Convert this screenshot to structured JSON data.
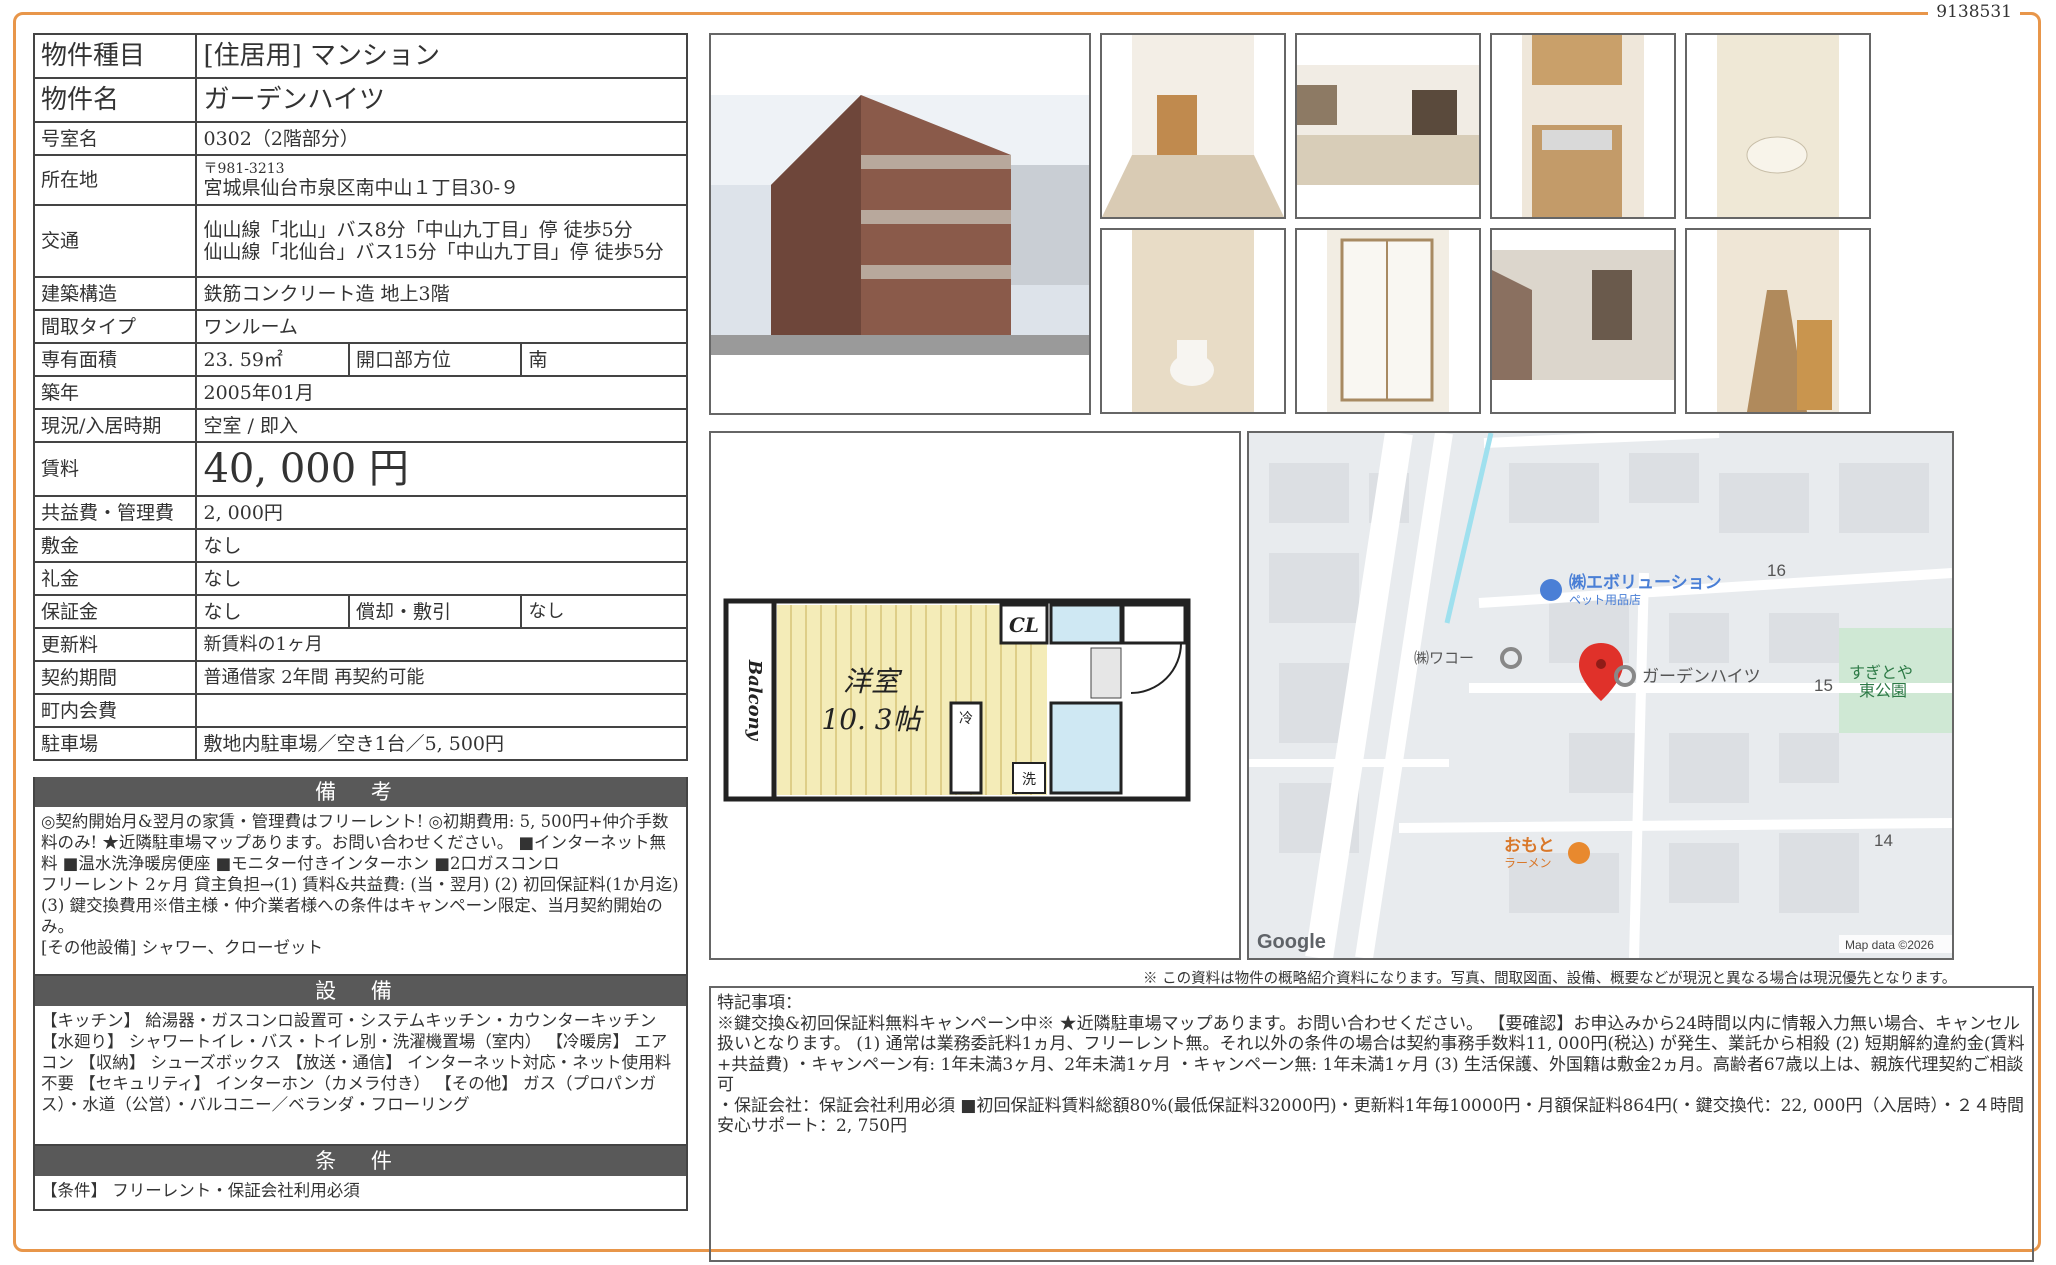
{
  "doc_id": "9138531",
  "spec": {
    "type_label": "物件種目",
    "type_value": "[住居用]  マンション",
    "name_label": "物件名",
    "name_value": "ガーデンハイツ",
    "room_label": "号室名",
    "room_value": "0302（2階部分）",
    "address_label": "所在地",
    "zip": "〒981-3213",
    "address": "宮城県仙台市泉区南中山１丁目30-９",
    "transit_label": "交通",
    "transit_1": "仙山線「北山」バス8分「中山九丁目」停  徒歩5分",
    "transit_2": "仙山線「北仙台」バス15分「中山九丁目」停  徒歩5分",
    "structure_label": "建築構造",
    "structure_value": "鉄筋コンクリート造  地上3階",
    "layout_label": "間取タイプ",
    "layout_value": "ワンルーム",
    "area_label": "専有面積",
    "area_value": "23. 59㎡",
    "direction_label": "開口部方位",
    "direction_value": "南",
    "built_label": "築年",
    "built_value": "2005年01月",
    "status_label": "現況/入居時期",
    "status_value": "空室  /  即入",
    "rent_label": "賃料",
    "rent_value": "40, 000  円",
    "fee_label": "共益費・管理費",
    "fee_value": "2, 000円",
    "deposit_label": "敷金",
    "deposit_value": "なし",
    "key_money_label": "礼金",
    "key_money_value": "なし",
    "guarantee_label": "保証金",
    "guarantee_value": "なし",
    "amort_label": "償却・敷引",
    "amort_value": "なし",
    "renewal_label": "更新料",
    "renewal_value": "新賃料の1ヶ月",
    "contract_label": "契約期間",
    "contract_value": "普通借家  2年間  再契約可能",
    "community_label": "町内会費",
    "community_value": "",
    "parking_label": "駐車場",
    "parking_value": "敷地内駐車場／空き1台／5, 500円"
  },
  "remarks_panel": {
    "title": "備 考",
    "line_1": "◎契約開始月&翌月の家賃・管理費はフリーレント!   ◎初期費用: 5, 500円+仲介手数料のみ!   ★近隣駐車場マップあります。お問い合わせください。   ■インターネット無料   ■温水洗浄暖房便座   ■モニター付きインターホン   ■2口ガスコンロ",
    "line_2": "フリーレント  2ヶ月  貸主負担→(1) 賃料&共益費: (当・翌月) (2) 初回保証料(1か月迄) (3) 鍵交換費用※借主様・仲介業者様への条件はキャンペーン限定、当月契約開始のみ。",
    "line_3": "[その他設備]  シャワー、クローゼット"
  },
  "equipment_panel": {
    "title": "設 備",
    "text": "【キッチン】 給湯器・ガスコンロ設置可・システムキッチン・カウンターキッチン  【水廻り】 シャワートイレ・バス・トイレ別・洗濯機置場（室内）  【冷暖房】 エアコン  【収納】 シューズボックス  【放送・通信】 インターネット対応・ネット使用料不要  【セキュリティ】 インターホン（カメラ付き）  【その他】 ガス（プロパンガス）・水道（公営）・バルコニー／ベランダ・フローリング"
  },
  "conditions_panel": {
    "title": "条 件",
    "text": "【条件】  フリーレント・保証会社利用必須"
  },
  "floor_plan": {
    "room_label": "洋室",
    "room_size": "10. 3帖",
    "balcony": "Balcony",
    "closet": "CL",
    "fridge": "冷",
    "washer": "洗"
  },
  "map": {
    "poi_1": "㈱エボリューション",
    "poi_1_sub": "ペット用品店",
    "poi_2": "㈱ワコー",
    "poi_3": "ガーデンハイツ",
    "poi_4": "おもと",
    "poi_4_sub": "ラーメン",
    "park": "すぎとや",
    "park_2": "東公園",
    "block_16": "16",
    "block_15": "15",
    "block_14": "14",
    "google": "Google",
    "attribution": "Map data ©2026"
  },
  "notice": "※  この資料は物件の概略紹介資料になります。写真、間取図面、設備、概要などが現況と異なる場合は現況優先となります。",
  "special_notes": {
    "heading": "特記事項：",
    "line_1": "※鍵交換&初回保証料無料キャンペーン中※    ★近隣駐車場マップあります。お問い合わせください。      【要確認】お申込みから24時間以内に情報入力無い場合、キャンセル扱いとなります。    (1) 通常は業務委託料1ヵ月、フリーレント無。それ以外の条件の場合は契約事務手数料11, 000円(税込) が発生、業託から相殺    (2) 短期解約違約金(賃料+共益費)    ・キャンペーン有: 1年未満3ヶ月、2年未満1ヶ月    ・キャンペーン無: 1年未満1ヶ月    (3) 生活保護、外国籍は敷金2ヵ月。高齢者67歳以上は、親族代理契約ご相談可",
    "line_2": "・保証会社：保証会社利用必須  ■初回保証料賃料総額80%(最低保証料32000円)・更新料1年毎10000円・月額保証料864円(・鍵交換代：22, 000円（入居時）・２４時間安心サポート：2, 750円"
  },
  "colors": {
    "frame": "#e8964a",
    "panel_header": "#595959",
    "map_pin": "#e0312a",
    "map_poi": "#4a7fd6",
    "map_food": "#e8892e"
  }
}
